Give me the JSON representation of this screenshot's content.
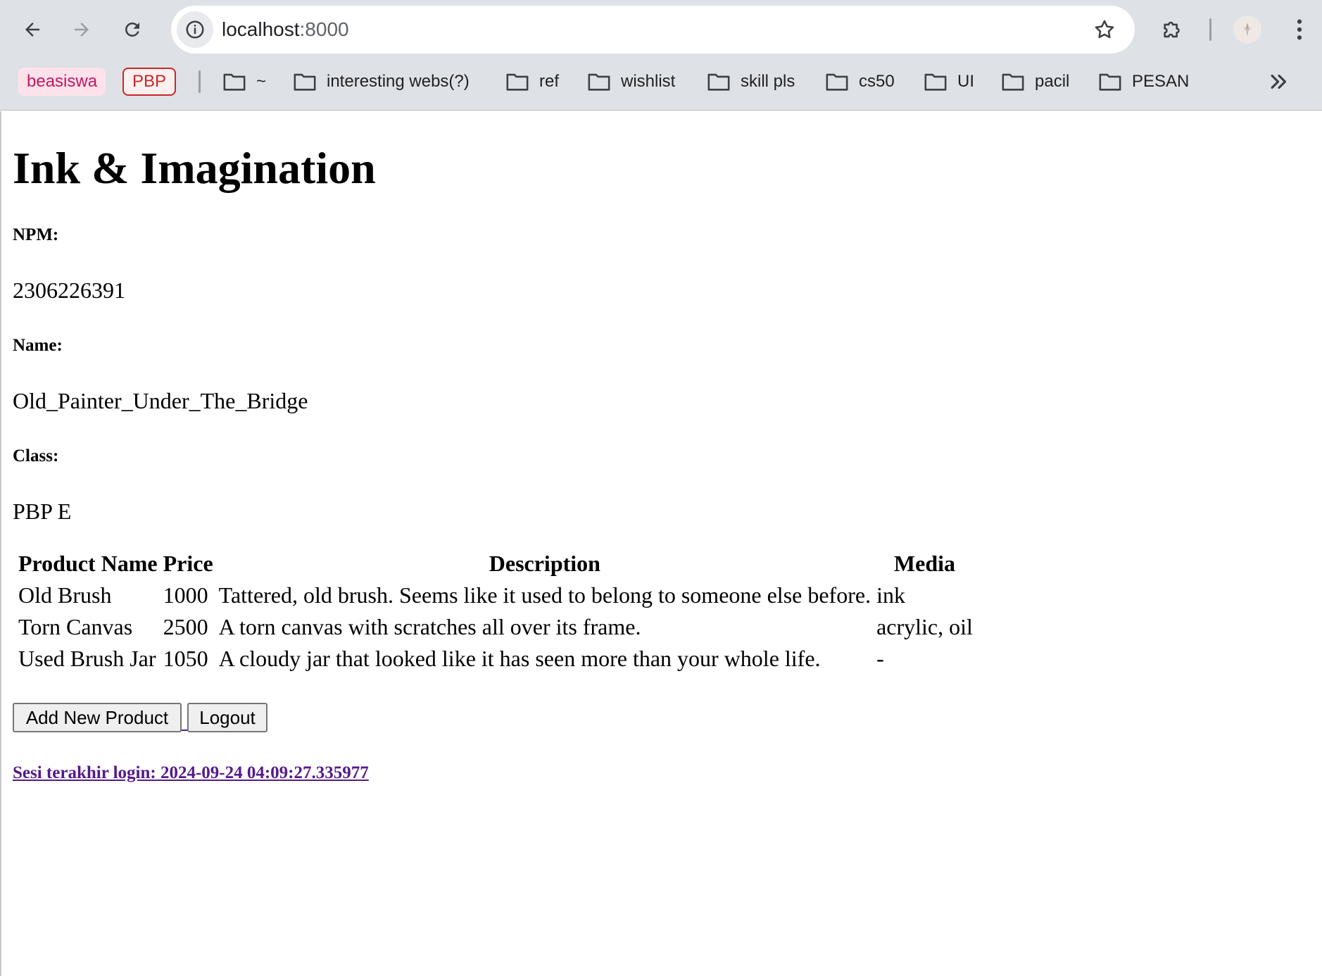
{
  "browser": {
    "url_host": "localhost",
    "url_port": ":8000",
    "bookmarks": {
      "chips": [
        "beasiswa",
        "PBP"
      ],
      "folders": [
        "~",
        "interesting webs(?)",
        "ref",
        "wishlist",
        "skill pls",
        "cs50",
        "UI",
        "pacil",
        "PESAN"
      ]
    }
  },
  "page": {
    "title": "Ink & Imagination",
    "npm_label": "NPM:",
    "npm_value": "2306226391",
    "name_label": "Name:",
    "name_value": "Old_Painter_Under_The_Bridge",
    "class_label": "Class:",
    "class_value": "PBP E",
    "table": {
      "headers": [
        "Product Name",
        "Price",
        "Description",
        "Media"
      ],
      "rows": [
        [
          "Old Brush",
          "1000",
          "Tattered, old brush. Seems like it used to belong to someone else before.",
          "ink"
        ],
        [
          "Torn Canvas",
          "2500",
          "A torn canvas with scratches all over its frame.",
          "acrylic, oil"
        ],
        [
          "Used Brush Jar",
          "1050",
          "A cloudy jar that looked like it has seen more than your whole life.",
          "-"
        ]
      ]
    },
    "add_button": "Add New Product",
    "logout_button": "Logout",
    "last_login": "Sesi terakhir login: 2024-09-24 04:09:27.335977"
  }
}
